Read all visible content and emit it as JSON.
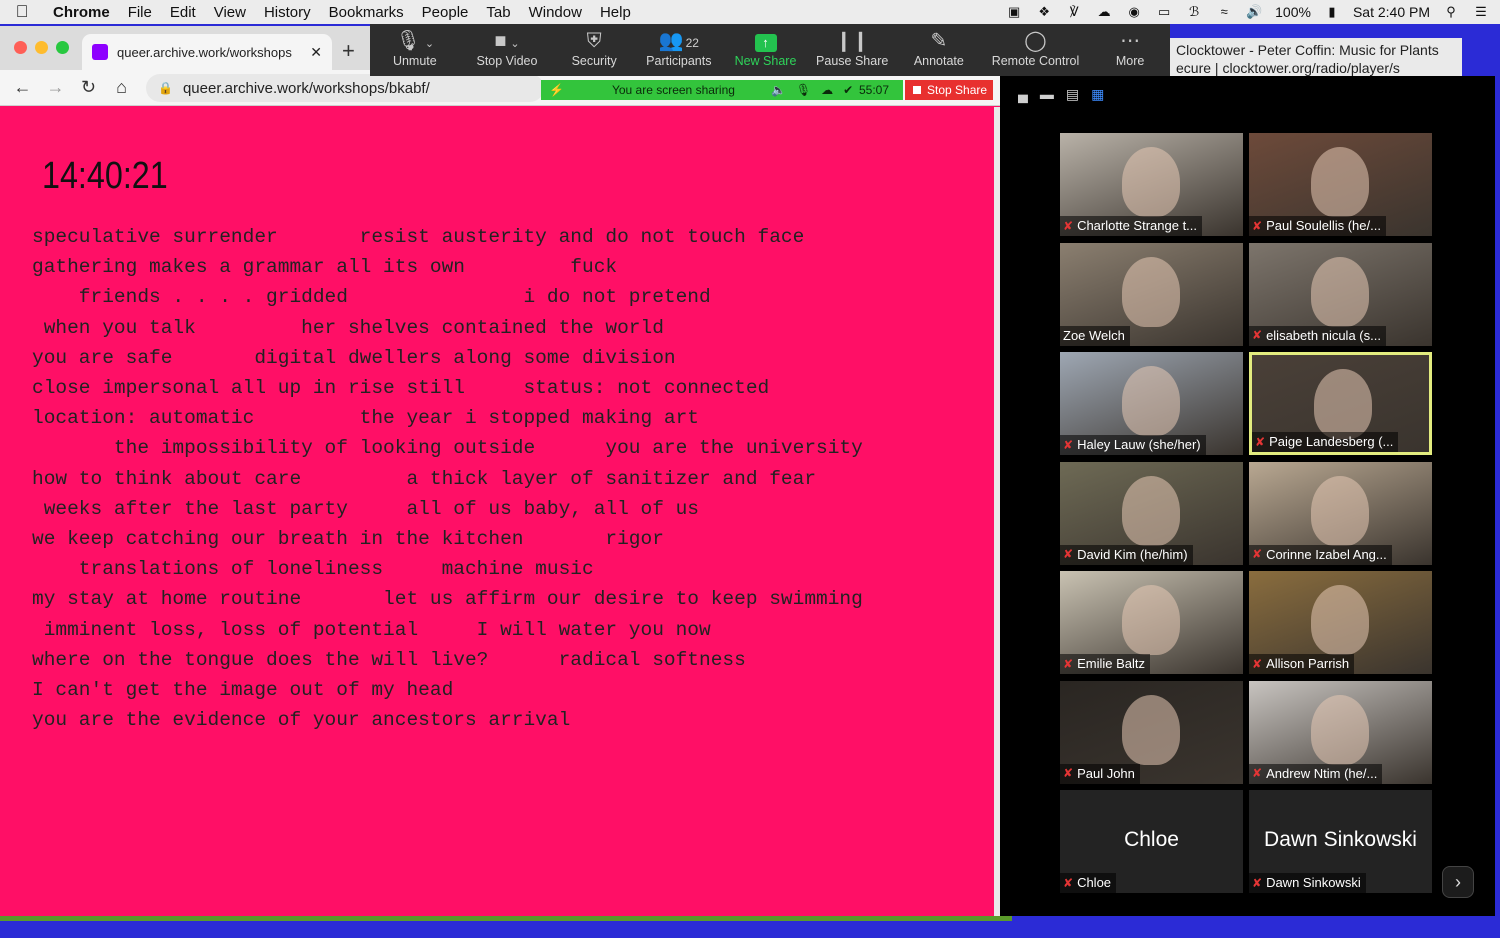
{
  "menubar": {
    "app": "Chrome",
    "items": [
      "File",
      "Edit",
      "View",
      "History",
      "Bookmarks",
      "People",
      "Tab",
      "Window",
      "Help"
    ],
    "battery": "100%",
    "clock": "Sat 2:40 PM"
  },
  "browser": {
    "tab_title": "queer.archive.work/workshops",
    "url": "queer.archive.work/workshops/bkabf/"
  },
  "zoom_toolbar": {
    "unmute": "Unmute",
    "stop_video": "Stop Video",
    "security": "Security",
    "participants": "Participants",
    "participant_count": "22",
    "new_share": "New Share",
    "pause_share": "Pause Share",
    "annotate": "Annotate",
    "remote_control": "Remote Control",
    "more": "More",
    "sharing_status": "You are screen sharing",
    "timer": "55:07",
    "stop_share": "Stop Share"
  },
  "background_window": {
    "title": "Clocktower - Peter Coffin: Music for Plants",
    "url_left": "ecure",
    "url_right": "clocktower.org/radio/player/s"
  },
  "page": {
    "clock": "14:40:21",
    "lines": [
      "speculative surrender       resist austerity and do not touch face",
      "gathering makes a grammar all its own         fuck",
      "    friends . . . . gridded               i do not pretend",
      " when you talk         her shelves contained the world",
      "you are safe       digital dwellers along some division",
      "close impersonal all up in rise still     status: not connected",
      "location: automatic         the year i stopped making art",
      "       the impossibility of looking outside      you are the university",
      "how to think about care         a thick layer of sanitizer and fear",
      " weeks after the last party     all of us baby, all of us",
      "we keep catching our breath in the kitchen       rigor",
      "    translations of loneliness     machine music",
      "my stay at home routine       let us affirm our desire to keep swimming",
      " imminent loss, loss of potential     I will water you now",
      "where on the tongue does the will live?      radical softness",
      "I can't get the image out of my head",
      "you are the evidence of your ancestors arrival"
    ]
  },
  "gallery": {
    "participants": [
      {
        "name": "Charlotte Strange t...",
        "muted": true,
        "bg": "#b9b2a8"
      },
      {
        "name": "Paul Soulellis (he/...",
        "muted": true,
        "bg": "#6d4a3a"
      },
      {
        "name": "Zoe Welch",
        "muted": false,
        "bg": "#8b7f70"
      },
      {
        "name": "elisabeth nicula (s...",
        "muted": true,
        "bg": "#7d756c"
      },
      {
        "name": "Haley Lauw (she/her)",
        "muted": true,
        "bg": "#9ea7b3"
      },
      {
        "name": "Paige Landesberg (...",
        "muted": true,
        "bg": "#4a4038",
        "active": true
      },
      {
        "name": "David Kim (he/him)",
        "muted": true,
        "bg": "#6e6a55"
      },
      {
        "name": "Corinne Izabel Ang...",
        "muted": true,
        "bg": "#b9a892"
      },
      {
        "name": "Emilie Baltz",
        "muted": true,
        "bg": "#c9c2b2"
      },
      {
        "name": "Allison Parrish",
        "muted": true,
        "bg": "#8a6d3e"
      },
      {
        "name": "Paul John",
        "muted": true,
        "bg": "#2a2622"
      },
      {
        "name": "Andrew Ntim (he/...",
        "muted": true,
        "bg": "#c8c4c0"
      },
      {
        "name": "Chloe",
        "muted": true,
        "noimg": true,
        "display_name": "Chloe"
      },
      {
        "name": "Dawn Sinkowski",
        "muted": true,
        "noimg": true,
        "display_name": "Dawn Sinkowski"
      }
    ]
  }
}
